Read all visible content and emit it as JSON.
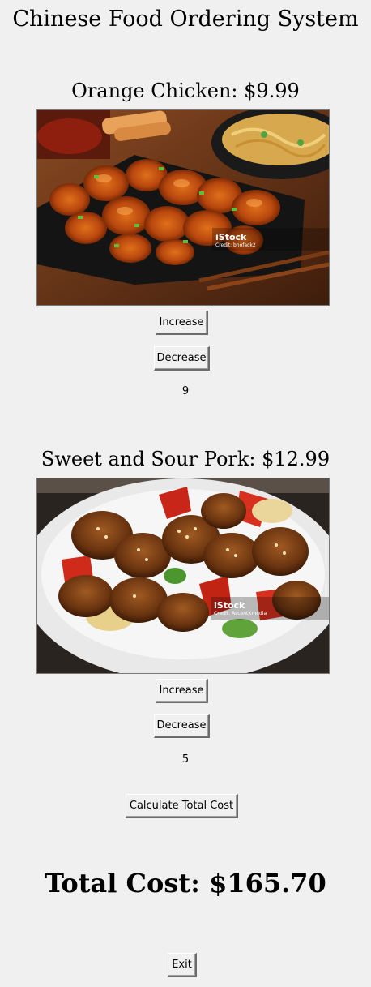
{
  "app": {
    "title": "Chinese Food Ordering System"
  },
  "items": [
    {
      "title": "Orange Chicken: $9.99",
      "increase_label": "Increase",
      "decrease_label": "Decrease",
      "quantity": "9",
      "photo_watermark": "iStock",
      "photo_credit": "Credit: bhofack2"
    },
    {
      "title": "Sweet and Sour Pork: $12.99",
      "increase_label": "Increase",
      "decrease_label": "Decrease",
      "quantity": "5",
      "photo_watermark": "iStock",
      "photo_credit": "Credit: AscentXmedia"
    }
  ],
  "actions": {
    "calculate_label": "Calculate Total Cost",
    "exit_label": "Exit"
  },
  "total": {
    "text": "Total Cost: $165.70"
  }
}
